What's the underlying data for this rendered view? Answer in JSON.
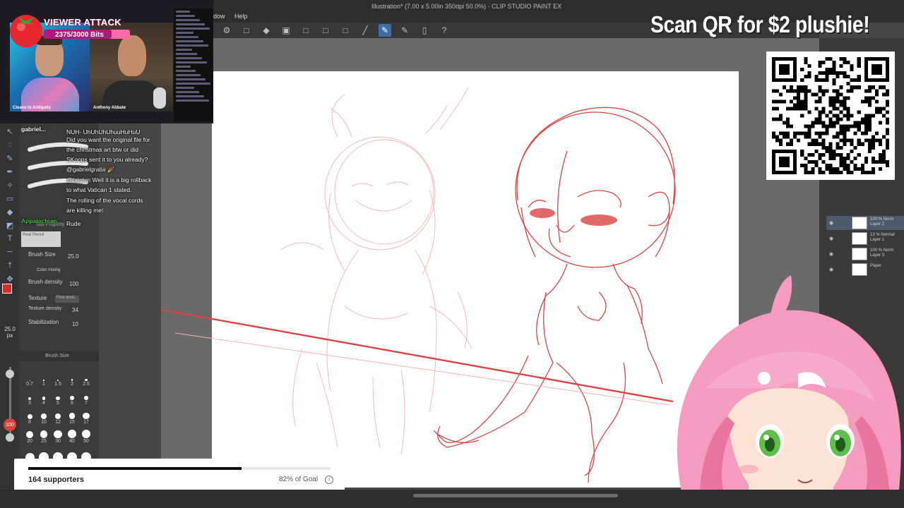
{
  "app": {
    "title": "Illustration* (7.00 x 5.00in 350dpi 50.0%) - CLIP STUDIO PAINT EX",
    "menu": [
      "dow",
      "Help"
    ]
  },
  "toolbar": {
    "icons": [
      "gear-icon",
      "blank-icon",
      "fill-icon",
      "frame-icon",
      "blank-icon",
      "blank-icon",
      "blank-icon",
      "line-icon",
      "pen-icon",
      "pen-icon",
      "page-icon",
      "help-icon"
    ],
    "active_index": 8
  },
  "stream_overlay": {
    "attack_title": "VIEWER ATTACK",
    "bits_text": "2375/3000 Bits",
    "bits_progress": 0.79,
    "cam_left_name": "Cleave to Antiquity",
    "cam_right_name": "Anthony Abbate",
    "promo": "Scan QR for $2 plushie!"
  },
  "chat": [
    {
      "user": "gabriel...",
      "text": "NUH- UhUhUhUhuuHuHuU",
      "user_color": "#ffffff"
    },
    {
      "user": "",
      "text": "Did you want the original file for",
      "user_color": "#ffffff"
    },
    {
      "user": "",
      "text": "the christmas art btw or did",
      "user_color": "#ffffff"
    },
    {
      "user": "",
      "text": "SKoops sent it to you already?",
      "user_color": "#ffffff"
    },
    {
      "user": "",
      "text": "@gabrielgratia 🎉",
      "user_color": "#ffffff"
    },
    {
      "user": "",
      "text": "@tatchm Well it is a big rollback",
      "user_color": "#ffffff"
    },
    {
      "user": "",
      "text": "to what Vatican 1 stated.",
      "user_color": "#ffffff"
    },
    {
      "user": "",
      "text": "The rolling of the vocal cords",
      "user_color": "#ffffff"
    },
    {
      "user": "",
      "text": "are killing me!",
      "user_color": "#ffffff"
    },
    {
      "user": "Appalachian...",
      "text": "Rude",
      "user_color": "#3ec43e"
    }
  ],
  "tool_property": {
    "header": "Tool Property",
    "brush_name": "Real Pencil",
    "brush_size_label": "Brush Size",
    "brush_size_value": "25.0",
    "color_mixing_label": "Color mixing",
    "brush_density_label": "Brush density",
    "brush_density_value": "100",
    "texture_label": "Texture",
    "texture_value": "Fine textu",
    "texture_density_label": "Texture density",
    "texture_density_value": "34",
    "stabilization_label": "Stabilization",
    "stabilization_value": "10",
    "brush_size_panel": "Brush Size",
    "size_readout": "25.0",
    "size_unit": "px",
    "badge": "100"
  },
  "brush_sizes": [
    "0.7",
    "1",
    "1.5",
    "2",
    "2.5",
    "3",
    "4",
    "5",
    "6",
    "7",
    "8",
    "10",
    "12",
    "15",
    "17",
    "20",
    "25",
    "30",
    "40",
    "50",
    "60",
    "70",
    "80",
    "100",
    "120"
  ],
  "layers": [
    {
      "line1": "100 % Norm",
      "line2": "Layer 2"
    },
    {
      "line1": "13 % Normal",
      "line2": "Layer 1"
    },
    {
      "line1": "100 % Norm",
      "line2": "Layer 3"
    },
    {
      "line1": "",
      "line2": "Paper"
    }
  ],
  "goal": {
    "supporters": "164 supporters",
    "percent_text": "82% of Goal",
    "progress": 0.82
  },
  "colors": {
    "accent": "#3f6fa8",
    "sketch_red": "#d94545",
    "brand_pink": "#ff6aa8"
  }
}
